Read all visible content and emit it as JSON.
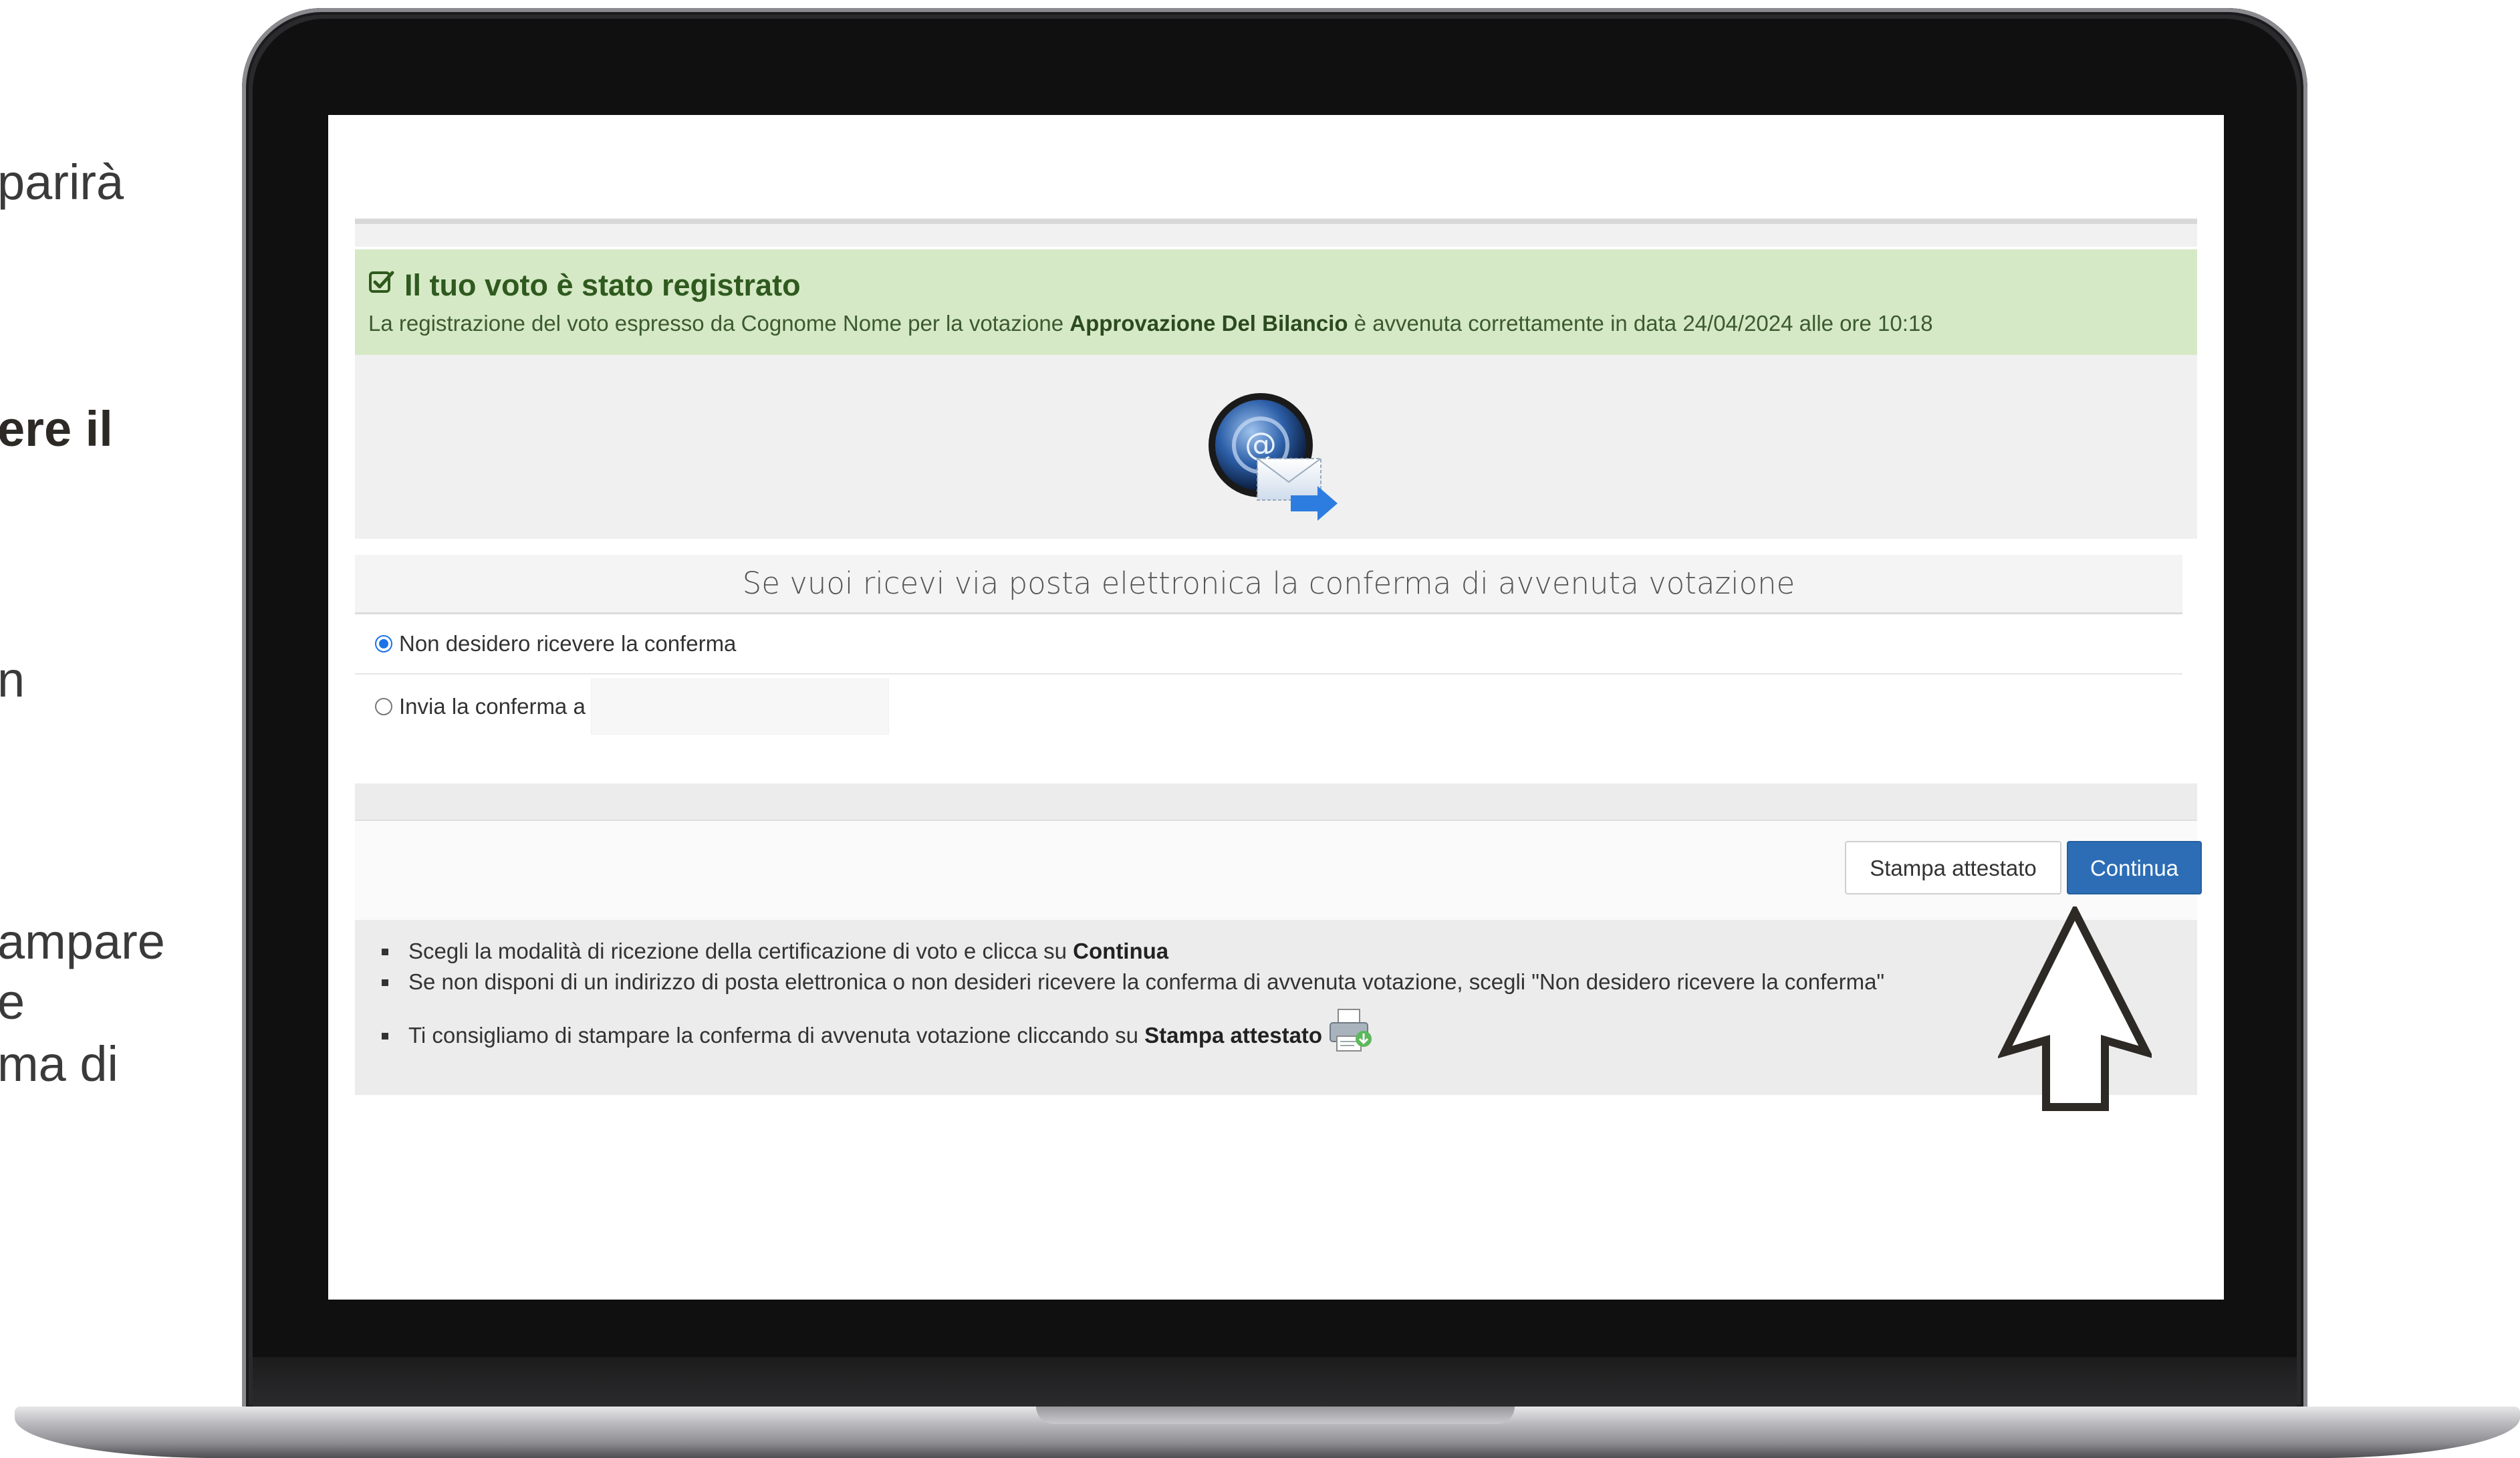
{
  "slide_fragments": {
    "f1": "parirà",
    "f2": "ere il",
    "f3": "n",
    "f4": "ampare",
    "f5": "e",
    "f6": "ma di"
  },
  "alert": {
    "title": "Il tuo voto è stato registrato",
    "text_pre": "La registrazione del voto espresso da Cognome Nome per la votazione ",
    "vote_name": "Approvazione Del Bilancio",
    "text_post": " è avvenuta correttamente in data 24/04/2024 alle ore 10:18",
    "icon": "check-square-icon",
    "color": "#d6e9c6"
  },
  "email_section": {
    "icon": "email-send-icon",
    "heading": "Se vuoi ricevi via posta elettronica la conferma di avvenuta votazione",
    "options": [
      {
        "label": "Non desidero ricevere la conferma",
        "selected": true
      },
      {
        "label": "Invia la conferma a",
        "selected": false
      }
    ],
    "email_value": ""
  },
  "buttons": {
    "print_label": "Stampa attestato",
    "continue_label": "Continua",
    "continue_color": "#2c6db5"
  },
  "help": {
    "item1_pre": "Scegli la modalità di ricezione della certificazione di voto e clicca su ",
    "item1_bold": "Continua",
    "item2": "Se non disponi di un indirizzo di posta elettronica o non desideri ricevere la conferma di avvenuta votazione, scegli \"Non desidero ricevere la conferma\"",
    "item3_pre": "Ti consigliamo di stampare la conferma di avvenuta votazione cliccando su ",
    "item3_bold": "Stampa attestato",
    "item3_icon": "printer-icon"
  },
  "annotation": {
    "icon": "pointer-arrow-icon"
  }
}
